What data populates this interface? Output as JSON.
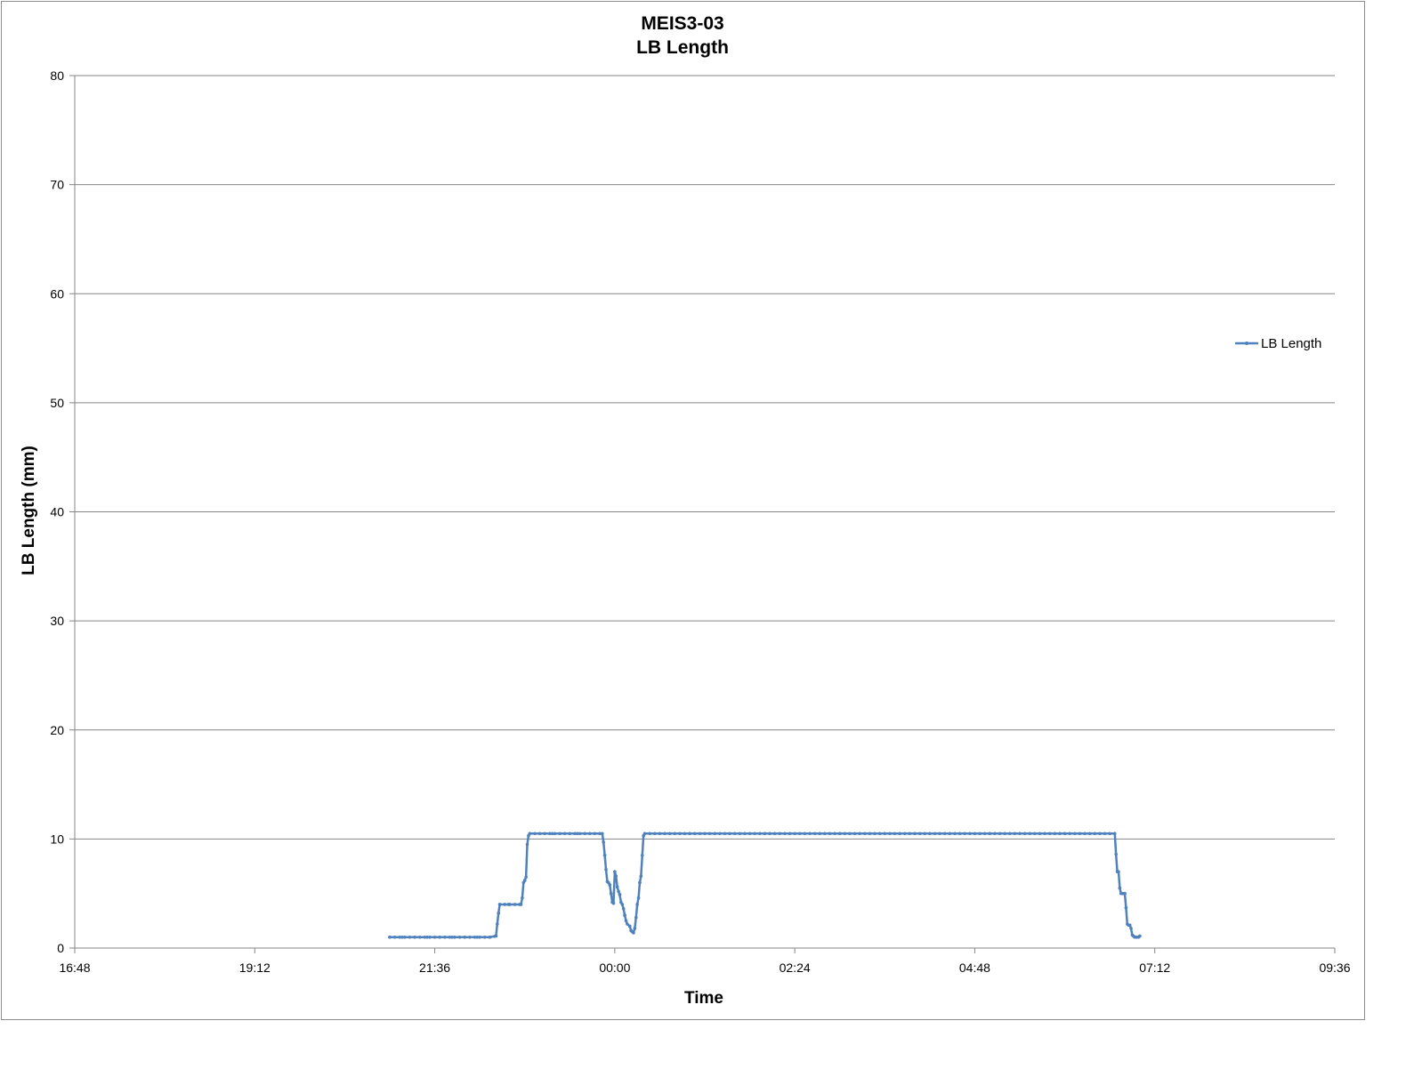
{
  "chart_data": {
    "type": "line",
    "title": "MEIS3-03",
    "subtitle": "LB Length",
    "xlabel": "Time",
    "ylabel": "LB Length (mm)",
    "xlim": [
      "16:48",
      "09:36"
    ],
    "ylim": [
      0,
      80
    ],
    "x_ticks": [
      "16:48",
      "19:12",
      "21:36",
      "00:00",
      "02:24",
      "04:48",
      "07:12",
      "09:36"
    ],
    "y_ticks": [
      "0",
      "10",
      "20",
      "30",
      "40",
      "50",
      "60",
      "70",
      "80"
    ],
    "grid": "horizontal",
    "legend_position": "right",
    "colors": {
      "series": "#4f81bd",
      "marker": "#4f81bd",
      "grid": "#868686",
      "axis": "#868686"
    },
    "series": [
      {
        "name": "LB Length",
        "points": [
          [
            "21:00",
            1.0
          ],
          [
            "21:10",
            1.0
          ],
          [
            "21:20",
            1.0
          ],
          [
            "21:30",
            1.0
          ],
          [
            "21:40",
            1.0
          ],
          [
            "21:50",
            1.0
          ],
          [
            "22:00",
            1.0
          ],
          [
            "22:10",
            1.0
          ],
          [
            "22:20",
            1.0
          ],
          [
            "22:25",
            1.1
          ],
          [
            "22:26",
            2.2
          ],
          [
            "22:27",
            3.2
          ],
          [
            "22:28",
            4.0
          ],
          [
            "22:35",
            4.0
          ],
          [
            "22:45",
            4.0
          ],
          [
            "22:46",
            4.6
          ],
          [
            "22:47",
            6.0
          ],
          [
            "22:48",
            6.2
          ],
          [
            "22:49",
            6.5
          ],
          [
            "22:50",
            9.5
          ],
          [
            "22:51",
            10.3
          ],
          [
            "22:52",
            10.5
          ],
          [
            "23:10",
            10.5
          ],
          [
            "23:30",
            10.5
          ],
          [
            "23:50",
            10.5
          ],
          [
            "23:51",
            9.7
          ],
          [
            "23:52",
            8.5
          ],
          [
            "23:53",
            7.2
          ],
          [
            "23:54",
            6.1
          ],
          [
            "23:55",
            6.0
          ],
          [
            "23:56",
            5.8
          ],
          [
            "23:57",
            5.0
          ],
          [
            "23:58",
            4.2
          ],
          [
            "23:59",
            4.1
          ],
          [
            "00:00",
            7.0
          ],
          [
            "00:01",
            6.6
          ],
          [
            "00:02",
            5.6
          ],
          [
            "00:03",
            5.2
          ],
          [
            "00:04",
            4.9
          ],
          [
            "00:05",
            4.2
          ],
          [
            "00:06",
            4.0
          ],
          [
            "00:07",
            3.6
          ],
          [
            "00:08",
            3.0
          ],
          [
            "00:09",
            2.5
          ],
          [
            "00:10",
            2.2
          ],
          [
            "00:12",
            2.0
          ],
          [
            "00:13",
            1.6
          ],
          [
            "00:14",
            1.5
          ],
          [
            "00:15",
            1.4
          ],
          [
            "00:16",
            1.8
          ],
          [
            "00:17",
            2.8
          ],
          [
            "00:18",
            4.0
          ],
          [
            "00:19",
            4.6
          ],
          [
            "00:20",
            6.0
          ],
          [
            "00:21",
            6.6
          ],
          [
            "00:22",
            8.5
          ],
          [
            "00:23",
            10.3
          ],
          [
            "00:24",
            10.5
          ],
          [
            "01:00",
            10.5
          ],
          [
            "02:00",
            10.5
          ],
          [
            "03:00",
            10.5
          ],
          [
            "04:00",
            10.5
          ],
          [
            "05:00",
            10.5
          ],
          [
            "06:00",
            10.5
          ],
          [
            "06:40",
            10.5
          ],
          [
            "06:41",
            8.6
          ],
          [
            "06:42",
            7.0
          ],
          [
            "06:43",
            7.0
          ],
          [
            "06:44",
            5.5
          ],
          [
            "06:45",
            5.0
          ],
          [
            "06:46",
            5.0
          ],
          [
            "06:47",
            5.0
          ],
          [
            "06:48",
            5.0
          ],
          [
            "06:49",
            3.7
          ],
          [
            "06:50",
            2.2
          ],
          [
            "06:51",
            2.1
          ],
          [
            "06:52",
            2.1
          ],
          [
            "06:53",
            1.8
          ],
          [
            "06:54",
            1.2
          ],
          [
            "06:55",
            1.1
          ],
          [
            "06:56",
            1.0
          ],
          [
            "06:57",
            1.0
          ],
          [
            "06:58",
            1.0
          ],
          [
            "06:59",
            1.0
          ],
          [
            "07:00",
            1.1
          ]
        ]
      }
    ]
  }
}
